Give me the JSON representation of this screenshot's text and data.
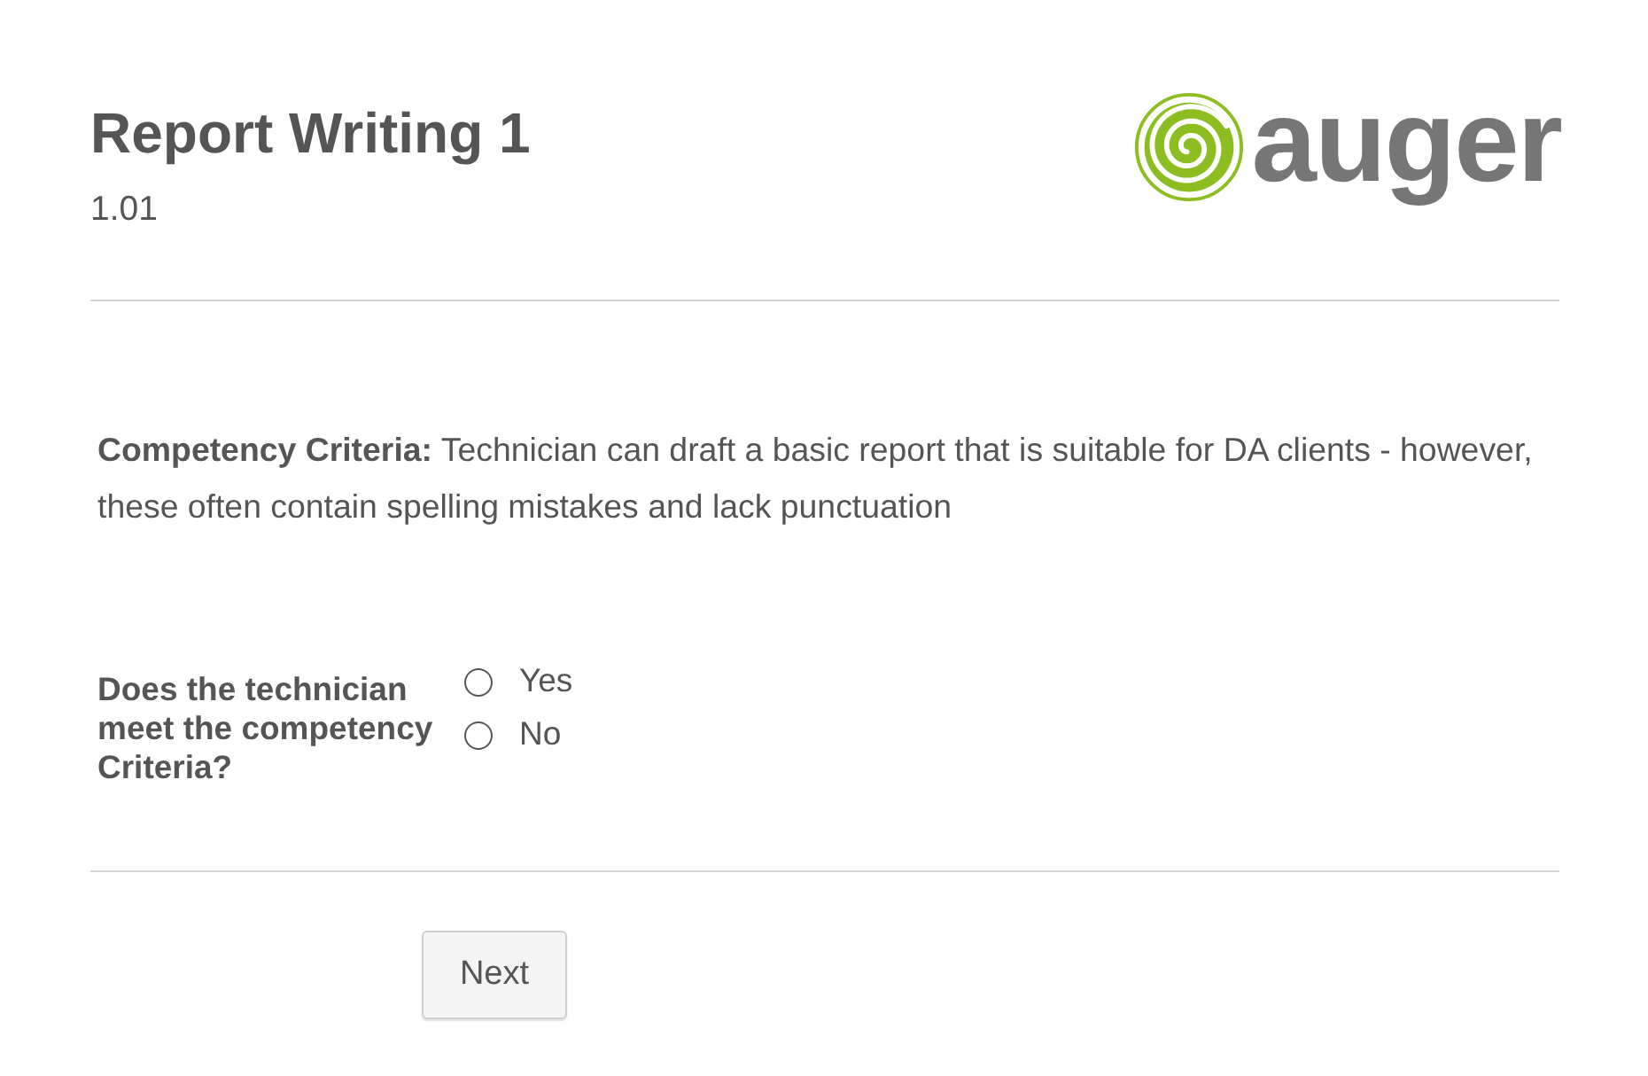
{
  "header": {
    "title": "Report Writing 1",
    "subtitle": "1.01",
    "logo": {
      "text": "auger"
    }
  },
  "criteria": {
    "text": "**Competency Criteria:** Technician can draft a basic report that is suitable for DA clients - however, these often contain spelling mistakes and lack punctuation"
  },
  "question": {
    "label": "Does the technician meet the competency Criteria?",
    "options": [
      {
        "label": "Yes",
        "selected": false
      },
      {
        "label": "No",
        "selected": false
      }
    ]
  },
  "buttons": [
    {
      "label": "Next"
    }
  ]
}
